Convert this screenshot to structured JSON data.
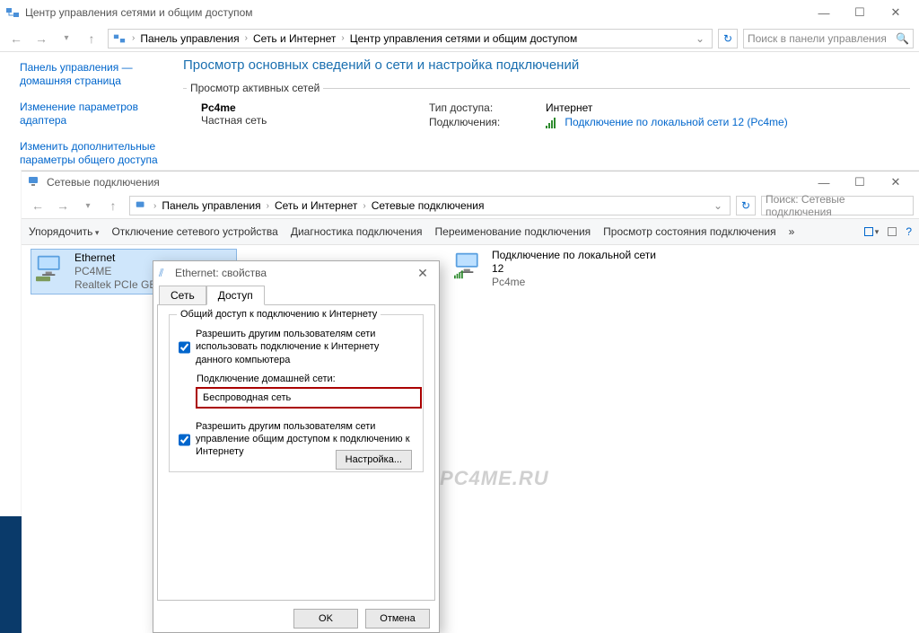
{
  "win1": {
    "title": "Центр управления сетями и общим доступом",
    "breadcrumb": [
      "Панель управления",
      "Сеть и Интернет",
      "Центр управления сетями и общим доступом"
    ],
    "search_placeholder": "Поиск в панели управления",
    "sidebar": [
      "Панель управления — домашняя страница",
      "Изменение параметров адаптера",
      "Изменить дополнительные параметры общего доступа"
    ],
    "heading": "Просмотр основных сведений о сети и настройка подключений",
    "active_label": "Просмотр активных сетей",
    "net": {
      "name": "Pc4me",
      "type": "Частная сеть",
      "access_label": "Тип доступа:",
      "access_value": "Интернет",
      "conn_label": "Подключения:",
      "conn_value": "Подключение по локальной сети 12 (Pc4me)"
    }
  },
  "win2": {
    "title": "Сетевые подключения",
    "breadcrumb": [
      "Панель управления",
      "Сеть и Интернет",
      "Сетевые подключения"
    ],
    "search_placeholder": "Поиск: Сетевые подключения",
    "toolbar": {
      "organize": "Упорядочить",
      "disable": "Отключение сетевого устройства",
      "diag": "Диагностика подключения",
      "rename": "Переименование подключения",
      "status": "Просмотр состояния подключения",
      "more": "»"
    },
    "conns": [
      {
        "name": "Ethernet",
        "line2": "PC4ME",
        "line3": "Realtek PCIe GBE..."
      },
      {
        "name": "Подключение по локальной сети 12",
        "line2": "",
        "line3": "Pc4me"
      }
    ]
  },
  "dlg": {
    "title": "Ethernet: свойства",
    "tabs": {
      "net": "Сеть",
      "access": "Доступ"
    },
    "group_title": "Общий доступ к подключению к Интернету",
    "chk1": "Разрешить другим пользователям сети использовать подключение к Интернету данного компьютера",
    "homenet_label": "Подключение домашней сети:",
    "homenet_value": "Беспроводная сеть",
    "chk2": "Разрешить другим пользователям сети управление общим доступом к подключению к Интернету",
    "settings_btn": "Настройка...",
    "ok": "OK",
    "cancel": "Отмена"
  },
  "watermark": "PC4ME.RU"
}
